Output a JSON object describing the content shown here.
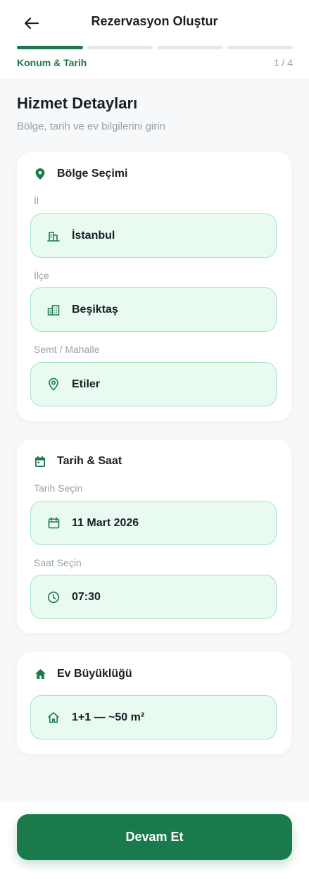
{
  "header": {
    "title": "Rezervasyon Oluştur",
    "step_label": "Konum & Tarih",
    "step_count": "1 / 4",
    "progress": {
      "current_step": 1,
      "total_steps": 4
    }
  },
  "intro": {
    "title": "Hizmet Detayları",
    "subtitle": "Bölge, tarih ve ev bilgilerini girin"
  },
  "region_card": {
    "title": "Bölge Seçimi",
    "icon": "location-pin-icon",
    "fields": [
      {
        "label": "İl",
        "value": "İstanbul",
        "icon": "city-building-icon"
      },
      {
        "label": "İlçe",
        "value": "Beşiktaş",
        "icon": "district-buildings-icon"
      },
      {
        "label": "Semt / Mahalle",
        "value": "Etiler",
        "icon": "location-outline-icon"
      }
    ]
  },
  "datetime_card": {
    "title": "Tarih & Saat",
    "icon": "calendar-icon",
    "fields": [
      {
        "label": "Tarih Seçin",
        "value": "11 Mart 2026",
        "icon": "calendar-outline-icon"
      },
      {
        "label": "Saat Seçin",
        "value": "07:30",
        "icon": "clock-icon"
      }
    ]
  },
  "home_card": {
    "title": "Ev Büyüklüğü",
    "icon": "home-icon",
    "value": "1+1 — ~50 m²",
    "value_icon": "home-outline-icon"
  },
  "footer": {
    "continue_label": "Devam Et"
  },
  "colors": {
    "primary": "#1b7a4c",
    "field_bg": "#e9fbf1",
    "field_border": "#a6e3c2",
    "page_bg": "#f6f8f9",
    "muted_text": "#9aa1a9"
  }
}
